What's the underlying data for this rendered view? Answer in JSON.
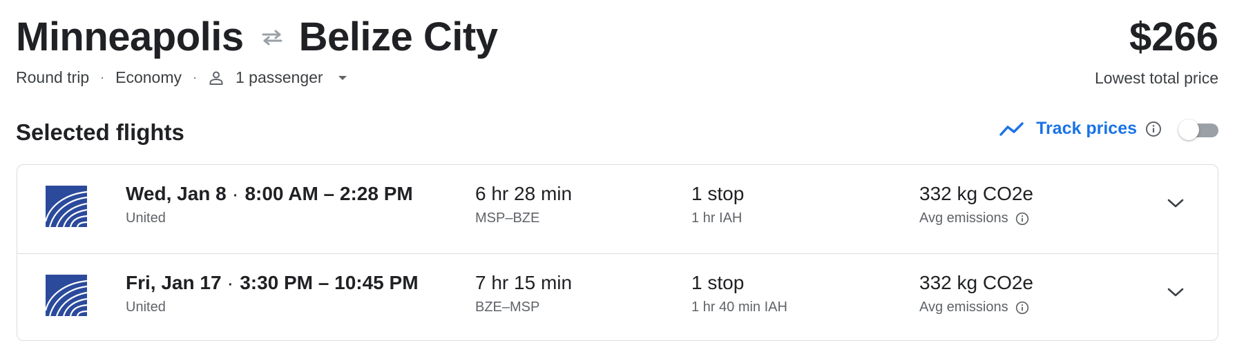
{
  "header": {
    "origin": "Minneapolis",
    "destination": "Belize City",
    "swap_icon": "swap-arrows-icon",
    "price": "$266",
    "price_caption": "Lowest total price",
    "trip_type": "Round trip",
    "cabin_class": "Economy",
    "passengers": "1 passenger",
    "separator": "·"
  },
  "selected": {
    "title": "Selected flights",
    "track_label": "Track prices",
    "track_toggle_on": false,
    "accent_color": "#1a73e8"
  },
  "flights": [
    {
      "date": "Wed, Jan 8",
      "times": "8:00 AM – 2:28 PM",
      "airline": "United",
      "duration": "6 hr 28 min",
      "route": "MSP–BZE",
      "stops": "1 stop",
      "layover": "1 hr IAH",
      "emissions": "332 kg CO2e",
      "emissions_label": "Avg emissions"
    },
    {
      "date": "Fri, Jan 17",
      "times": "3:30 PM – 10:45 PM",
      "airline": "United",
      "duration": "7 hr 15 min",
      "route": "BZE–MSP",
      "stops": "1 stop",
      "layover": "1 hr 40 min IAH",
      "emissions": "332 kg CO2e",
      "emissions_label": "Avg emissions"
    }
  ],
  "colors": {
    "text_primary": "#202124",
    "text_secondary": "#5f6368",
    "border": "#dadce0",
    "united_blue": "#2b4a9c"
  }
}
